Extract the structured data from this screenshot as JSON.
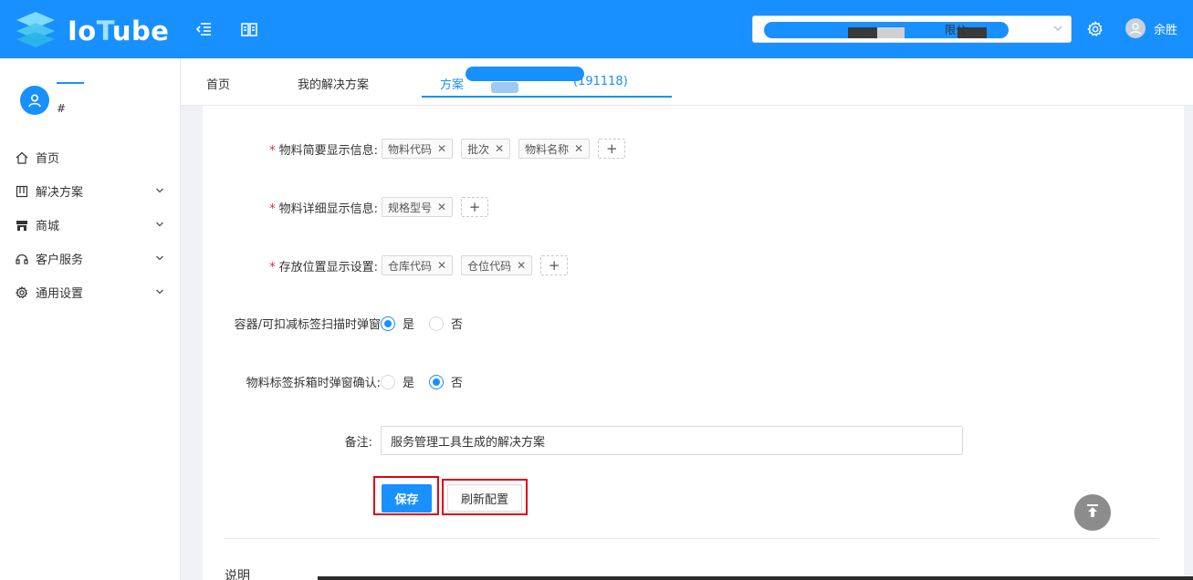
{
  "header": {
    "logo_prefix": "Io",
    "logo_t": "T",
    "logo_suffix": "ube",
    "org_select_partial_text": "限公",
    "user_name": "余胜"
  },
  "sidebar": {
    "profile_hash": "#",
    "items": [
      {
        "label": "首页",
        "icon": "home-icon",
        "has_children": false
      },
      {
        "label": "解决方案",
        "icon": "solution-icon",
        "has_children": true
      },
      {
        "label": "商城",
        "icon": "shop-icon",
        "has_children": true
      },
      {
        "label": "客户服务",
        "icon": "headset-icon",
        "has_children": true
      },
      {
        "label": "通用设置",
        "icon": "gear-icon",
        "has_children": true
      }
    ]
  },
  "tabs": [
    {
      "label": "首页",
      "active": false
    },
    {
      "label": "我的解决方案",
      "active": false
    },
    {
      "label": "方案",
      "active": true,
      "suffix": "(191118)"
    }
  ],
  "form": {
    "brief_info": {
      "label": "物料简要显示信息:",
      "required": true,
      "tags": [
        "物料代码",
        "批次",
        "物料名称"
      ]
    },
    "detail_info": {
      "label": "物料详细显示信息:",
      "required": true,
      "tags": [
        "规格型号"
      ]
    },
    "storage_info": {
      "label": "存放位置显示设置:",
      "required": true,
      "tags": [
        "仓库代码",
        "仓位代码"
      ]
    },
    "container_popup": {
      "label": "容器/可扣减标签扫描时弹窗",
      "options": [
        "是",
        "否"
      ],
      "selected": "是"
    },
    "split_popup": {
      "label": "物料标签拆箱时弹窗确认:",
      "options": [
        "是",
        "否"
      ],
      "selected": "否"
    },
    "remark": {
      "label": "备注:",
      "value": "服务管理工具生成的解决方案"
    },
    "save_label": "保存",
    "refresh_label": "刷新配置"
  },
  "section": {
    "title": "说明"
  },
  "colors": {
    "primary": "#1890ff",
    "required": "#f5222d",
    "highlight_box": "#e0000f"
  }
}
